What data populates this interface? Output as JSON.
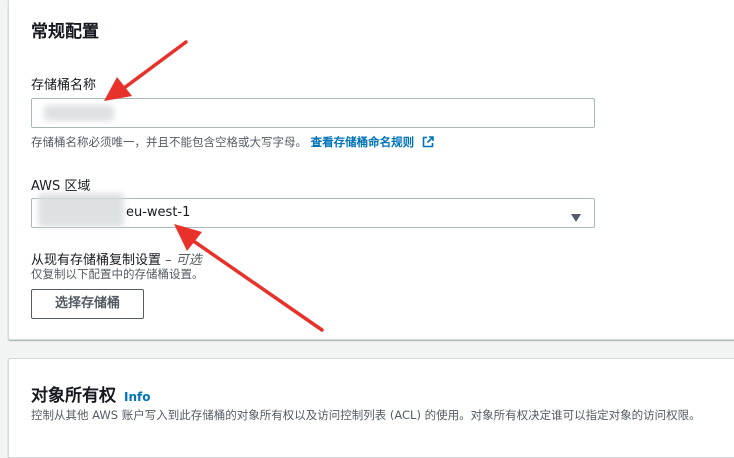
{
  "general": {
    "title": "常规配置",
    "bucket_name": {
      "label": "存储桶名称",
      "value": "",
      "hint": "存储桶名称必须唯一，并且不能包含空格或大写字母。",
      "rules_link": "查看存储桶命名规则"
    },
    "region": {
      "label": "AWS 区域",
      "value": "eu-west-1"
    },
    "copy_settings": {
      "label": "从现有存储桶复制设置",
      "optional": "– 可选",
      "hint": "仅复制以下配置中的存储桶设置。",
      "button": "选择存储桶"
    }
  },
  "ownership": {
    "title": "对象所有权",
    "info": "Info",
    "description": "控制从其他 AWS 账户写入到此存储桶的对象所有权以及访问控制列表 (ACL) 的使用。对象所有权决定谁可以指定对象的访问权限。"
  },
  "colors": {
    "link": "#0073bb",
    "annotation_arrow": "#e8312a"
  }
}
